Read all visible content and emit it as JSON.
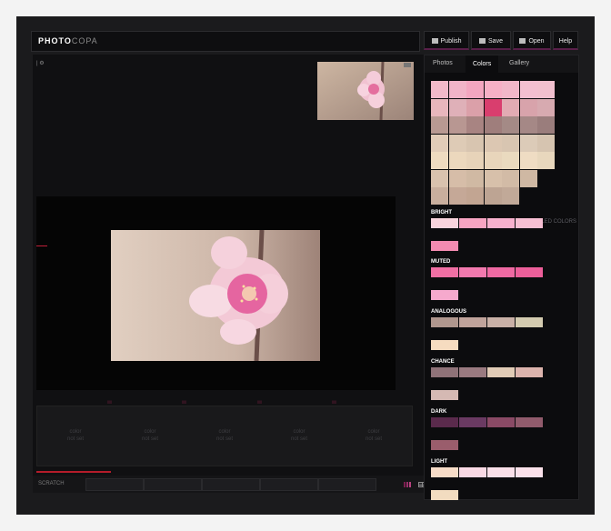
{
  "app": {
    "logo_primary": "PHOTO",
    "logo_secondary": "COPA",
    "buttons": {
      "publish": "Publish",
      "save": "Save",
      "open": "Open",
      "help": "Help"
    }
  },
  "workspace": {
    "controls": {
      "toggle": "| ⚙",
      "side_toggle": "| ≡"
    },
    "markers": [
      "|||||",
      "|||||",
      "|||||",
      "|||||"
    ],
    "slots": [
      {
        "line1": "color",
        "line2": "not set"
      },
      {
        "line1": "color",
        "line2": "not set"
      },
      {
        "line1": "color",
        "line2": "not set"
      },
      {
        "line1": "color",
        "line2": "not set"
      },
      {
        "line1": "color",
        "line2": "not set"
      }
    ],
    "scratch": {
      "label": "SCRATCH"
    }
  },
  "panel": {
    "tabs": {
      "photos": "Photos",
      "colors": "Colors",
      "gallery": "Gallery"
    },
    "sampled_label": "SAMPLED COLORS",
    "grid_colors": [
      [
        "#f2b9c9",
        "#f1b4c8",
        "#f3a6c0",
        "#f6b0c6",
        "#f1b7c9",
        "#f3bfd0",
        "#f2c0ce"
      ],
      [
        "#e8b6bc",
        "#dfb0b8",
        "#dba0a9",
        "#d93e6e",
        "#e2abb3",
        "#d8a3ab",
        "#d7aab0"
      ],
      [
        "#b89992",
        "#b89792",
        "#a88482",
        "#9f7e7c",
        "#a48a86",
        "#a58886",
        "#9a7d7c"
      ],
      [
        "#e1ccb8",
        "#decbb6",
        "#d8c5b0",
        "#dcc7b2",
        "#d8c5b1",
        "#dccbb8",
        "#d6c4b0"
      ],
      [
        "#eedbc0",
        "#ecd8bd",
        "#e7d3b9",
        "#e8d5bb",
        "#eadabf",
        "#efdcc3",
        "#e8d7bd"
      ],
      [
        "#d9c2ae",
        "#d6bda8",
        "#d0b9a3",
        "#d7c0aa",
        "#d2bba6",
        "#cfb8a3"
      ],
      [
        "#c8ae9d",
        "#c5a897",
        "#c2a592",
        "#bda493",
        "#c1a998"
      ]
    ],
    "bright_label": "BRIGHT",
    "bright": [
      "#f9d4dd",
      "#f7a4c2",
      "#f7b1ce",
      "#f7bfd3",
      "#f38bb1"
    ],
    "muted_label": "MUTED",
    "muted": [
      "#f06fa4",
      "#f279ae",
      "#ef69a2",
      "#ed5f9a",
      "#f6a9cd"
    ],
    "analogous_label": "ANALOGOUS",
    "analogous": [
      "#b0978e",
      "#c0a39b",
      "#c9b0a6",
      "#d4cbb0",
      "#f6dcc0"
    ],
    "chance_label": "CHANCE",
    "chance": [
      "#8f7278",
      "#9a7a80",
      "#e1cbb6",
      "#dcb4ad",
      "#d5b9b3"
    ],
    "dark_label": "DARK",
    "dark": [
      "#5a2a4c",
      "#6a3a62",
      "#8a4a65",
      "#915b6c",
      "#9a5d6c"
    ],
    "light_label": "LIGHT",
    "light": [
      "#f7dcc8",
      "#f9d9e4",
      "#f9dfe8",
      "#fbe1ea",
      "#f2dcc0"
    ]
  },
  "colors": {
    "accent": "#5a1f4a",
    "progress": "#b41c2a",
    "background": "#1b1b1d"
  },
  "icons": {
    "publish": "publish-icon",
    "save": "save-icon",
    "open": "open-icon",
    "scratch_a": "palette-icon",
    "scratch_b": "grid-icon"
  }
}
